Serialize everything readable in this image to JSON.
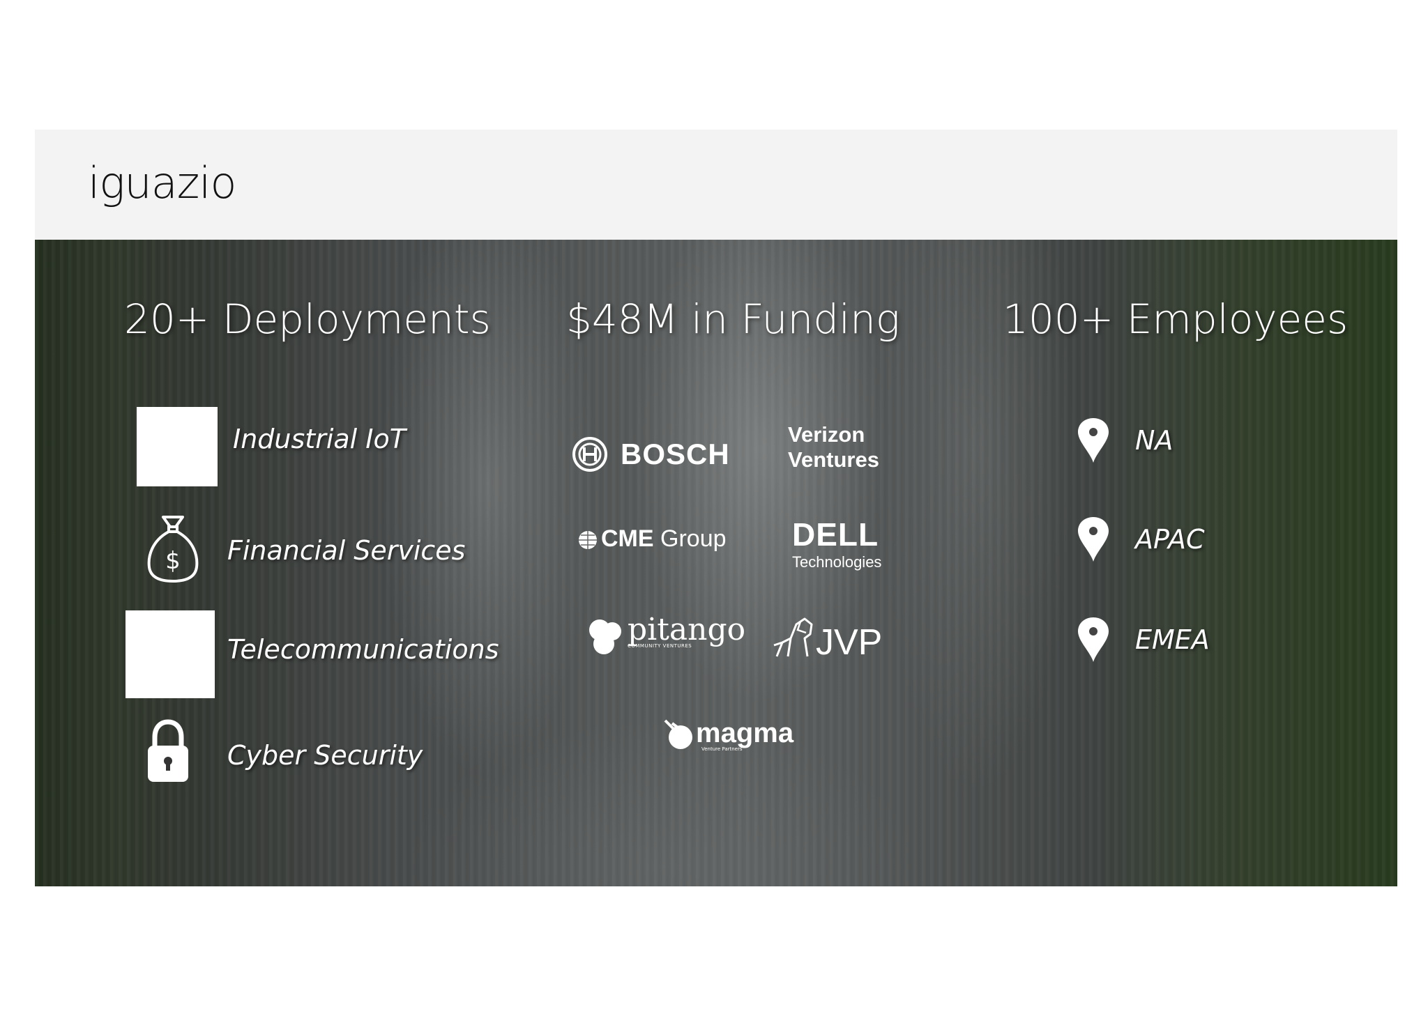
{
  "brand": "iguazio",
  "columns": {
    "deployments": {
      "heading": "20+ Deployments",
      "items": [
        {
          "label": "Industrial IoT",
          "icon": "image-placeholder"
        },
        {
          "label": "Financial Services",
          "icon": "money-bag-icon"
        },
        {
          "label": "Telecommunications",
          "icon": "image-placeholder"
        },
        {
          "label": "Cyber Security",
          "icon": "padlock-icon"
        }
      ]
    },
    "funding": {
      "heading": "$48M in Funding",
      "logos": {
        "bosch": "BOSCH",
        "verizon_line1": "Verizon",
        "verizon_line2": "Ventures",
        "cme_bold": "CME",
        "cme_rest": "Group",
        "dell": "DELL",
        "dell_sub": "Technologies",
        "pitango": "pitango",
        "pitango_sub": "COMMUNITY VENTURES",
        "jvp": "JVP",
        "magma": "magma",
        "magma_sub": "Venture Partners"
      }
    },
    "employees": {
      "heading": "100+ Employees",
      "regions": [
        "NA",
        "APAC",
        "EMEA"
      ]
    }
  },
  "colors": {
    "header_bg": "#f3f3f3",
    "text_light": "#ffffff",
    "brand_text": "#111111"
  }
}
